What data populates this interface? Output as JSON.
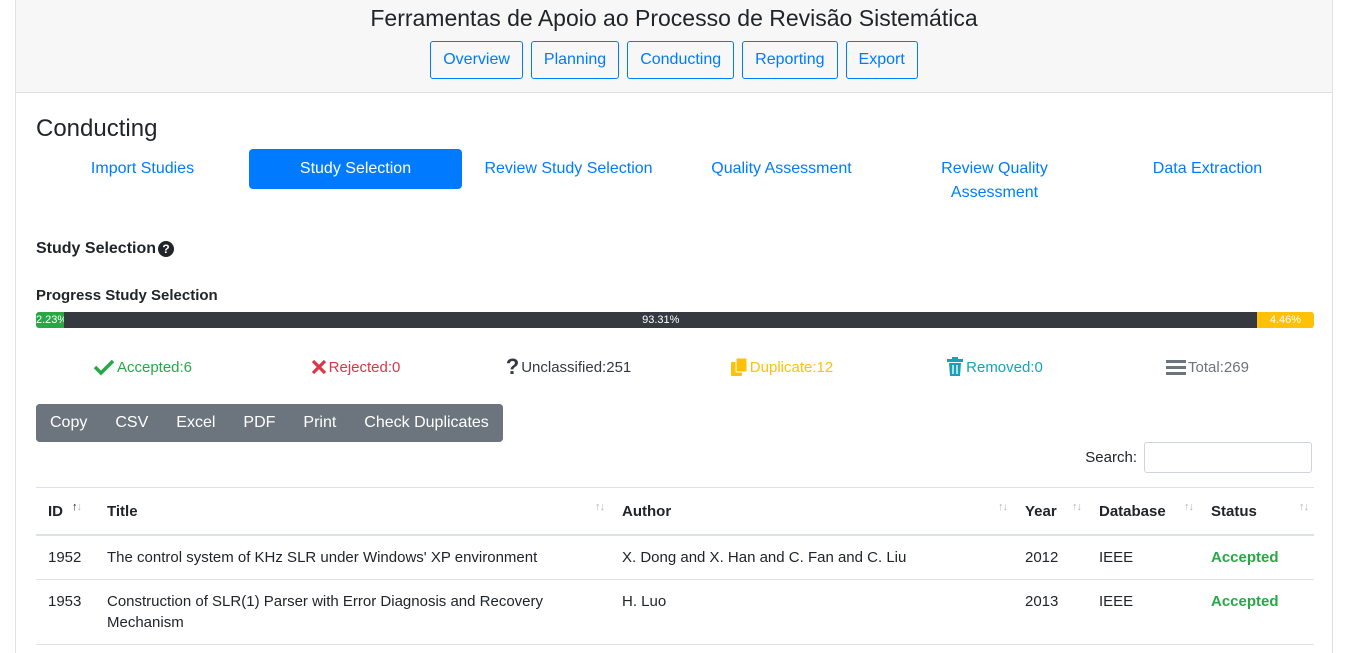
{
  "app": {
    "title": "Ferramentas de Apoio ao Processo de Revisão Sistemática"
  },
  "main_nav": [
    {
      "label": "Overview"
    },
    {
      "label": "Planning"
    },
    {
      "label": "Conducting"
    },
    {
      "label": "Reporting"
    },
    {
      "label": "Export"
    }
  ],
  "section": {
    "title": "Conducting"
  },
  "sub_tabs": [
    {
      "label": "Import Studies",
      "active": false
    },
    {
      "label": "Study Selection",
      "active": true
    },
    {
      "label": "Review Study Selection",
      "active": false
    },
    {
      "label": "Quality Assessment",
      "active": false
    },
    {
      "label": "Review Quality Assessment",
      "active": false
    },
    {
      "label": "Data Extraction",
      "active": false
    }
  ],
  "study_selection": {
    "heading": "Study Selection",
    "help_icon": "question-circle-icon"
  },
  "progress": {
    "label": "Progress Study Selection",
    "segments": [
      {
        "name": "accepted",
        "text": "2.23%",
        "percent": 2.23,
        "color": "#28a745"
      },
      {
        "name": "unclassified",
        "text": "93.31%",
        "percent": 93.31,
        "color": "#343a40"
      },
      {
        "name": "duplicate",
        "text": "4.46%",
        "percent": 4.46,
        "color": "#ffc107"
      }
    ]
  },
  "stats": [
    {
      "icon": "check-icon",
      "label": "Accepted:6",
      "color": "#28a745"
    },
    {
      "icon": "times-icon",
      "label": "Rejected:0",
      "color": "#dc3545"
    },
    {
      "icon": "question-icon",
      "label": "Unclassified:251",
      "color": "#343a40"
    },
    {
      "icon": "copy-icon",
      "label": "Duplicate:12",
      "color": "#ffc107"
    },
    {
      "icon": "trash-icon",
      "label": "Removed:0",
      "color": "#17a2b8"
    },
    {
      "icon": "bars-icon",
      "label": "Total:269",
      "color": "#6c757d"
    }
  ],
  "toolbar": [
    "Copy",
    "CSV",
    "Excel",
    "PDF",
    "Print",
    "Check Duplicates"
  ],
  "search": {
    "label": "Search:",
    "value": ""
  },
  "table": {
    "columns": [
      "ID",
      "Title",
      "Author",
      "Year",
      "Database",
      "Status"
    ],
    "rows": [
      {
        "id": "1952",
        "title": "The control system of KHz SLR under Windows' XP environment",
        "author": "X. Dong and X. Han and C. Fan and C. Liu",
        "year": "2012",
        "database": "IEEE",
        "status": "Accepted"
      },
      {
        "id": "1953",
        "title": "Construction of SLR(1) Parser with Error Diagnosis and Recovery Mechanism",
        "author": "H. Luo",
        "year": "2013",
        "database": "IEEE",
        "status": "Accepted"
      }
    ]
  }
}
